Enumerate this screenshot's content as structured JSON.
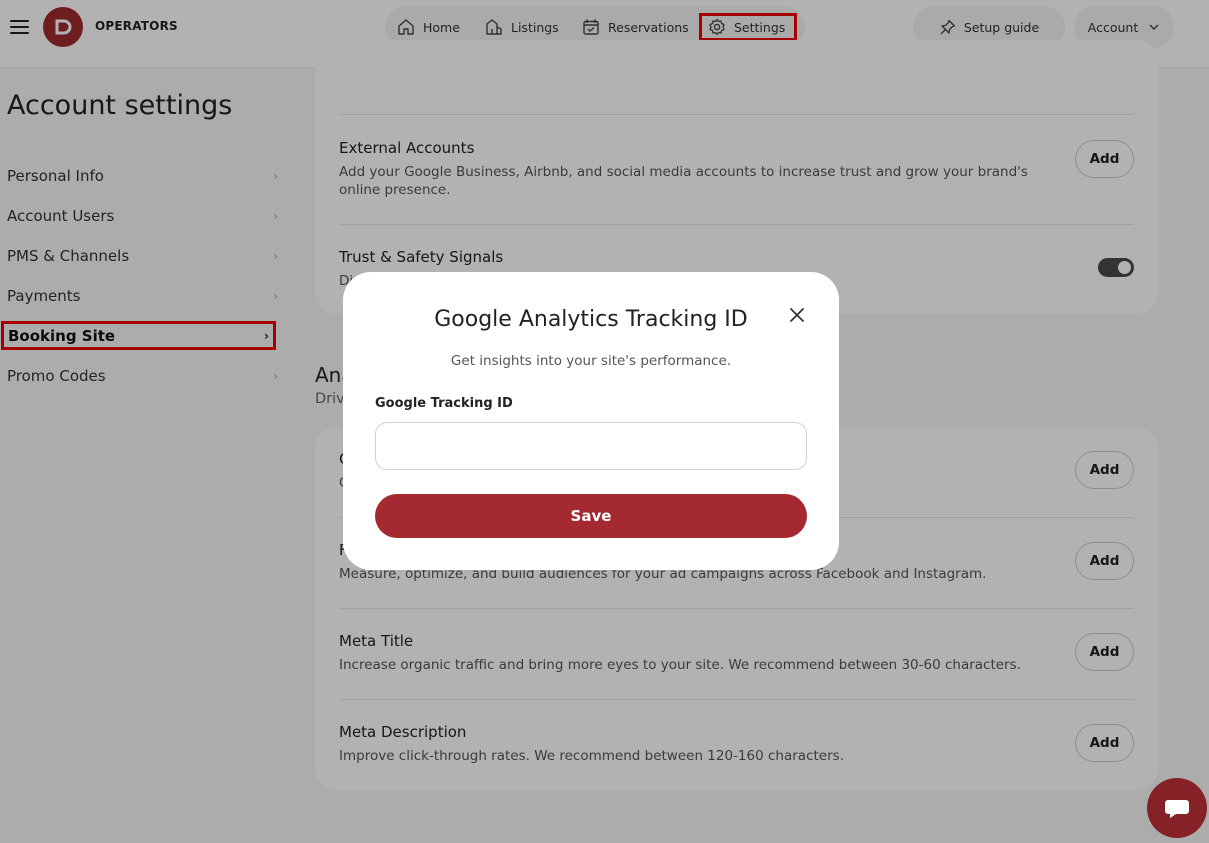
{
  "header": {
    "brand": "OPERATORS",
    "nav": [
      {
        "label": "Home",
        "icon": "home-icon"
      },
      {
        "label": "Listings",
        "icon": "listings-icon"
      },
      {
        "label": "Reservations",
        "icon": "calendar-icon"
      },
      {
        "label": "Settings",
        "icon": "gear-icon"
      }
    ],
    "setup_guide": "Setup guide",
    "account": "Account"
  },
  "sidebar": {
    "title": "Account settings",
    "items": [
      {
        "label": "Personal Info"
      },
      {
        "label": "Account Users"
      },
      {
        "label": "PMS & Channels"
      },
      {
        "label": "Payments"
      },
      {
        "label": "Booking Site",
        "active": true
      },
      {
        "label": "Promo Codes"
      }
    ]
  },
  "main": {
    "card1": {
      "external_accounts": {
        "title": "External Accounts",
        "desc": "Add your Google Business, Airbnb, and social media accounts to increase trust and grow your brand's online presence.",
        "button": "Add"
      },
      "trust_safety": {
        "title": "Trust & Safety Signals",
        "desc": "Di",
        "toggle_on": true
      }
    },
    "analytics": {
      "heading": "Ana",
      "sub": "Driv",
      "rows": [
        {
          "title": "G",
          "desc": "G",
          "button": "Add"
        },
        {
          "title": "F",
          "desc": "Measure, optimize, and build audiences for your ad campaigns across Facebook and Instagram.",
          "button": "Add"
        },
        {
          "title": "Meta Title",
          "desc": "Increase organic traffic and bring more eyes to your site. We recommend between 30-60 characters.",
          "button": "Add"
        },
        {
          "title": "Meta Description",
          "desc": "Improve click-through rates. We recommend between 120-160 characters.",
          "button": "Add"
        }
      ]
    }
  },
  "modal": {
    "title": "Google Analytics Tracking ID",
    "subtitle": "Get insights into your site's performance.",
    "field_label": "Google Tracking ID",
    "field_value": "",
    "field_placeholder": "",
    "save": "Save"
  },
  "colors": {
    "brand": "#9e2a30",
    "save_button": "#a52930",
    "highlight": "#ee0000"
  }
}
